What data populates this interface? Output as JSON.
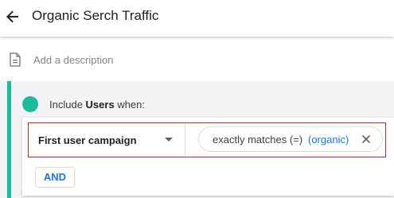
{
  "header": {
    "title": "Organic Serch Traffic",
    "back_icon": "arrow-back-icon"
  },
  "description": {
    "placeholder": "Add a description",
    "icon": "document-icon"
  },
  "condition_group": {
    "include_prefix": "Include",
    "include_subject": "Users",
    "include_suffix": "when:",
    "accent_color": "#1abc9c",
    "dimension": {
      "label": "First user campaign",
      "icon": "dropdown-arrow-icon"
    },
    "filter": {
      "operator_label": "exactly matches (=)",
      "value": "(organic)",
      "remove_icon": "close-icon"
    },
    "and_button": "AND"
  },
  "colors": {
    "link": "#1a73e8",
    "highlight_border": "#c62828"
  }
}
